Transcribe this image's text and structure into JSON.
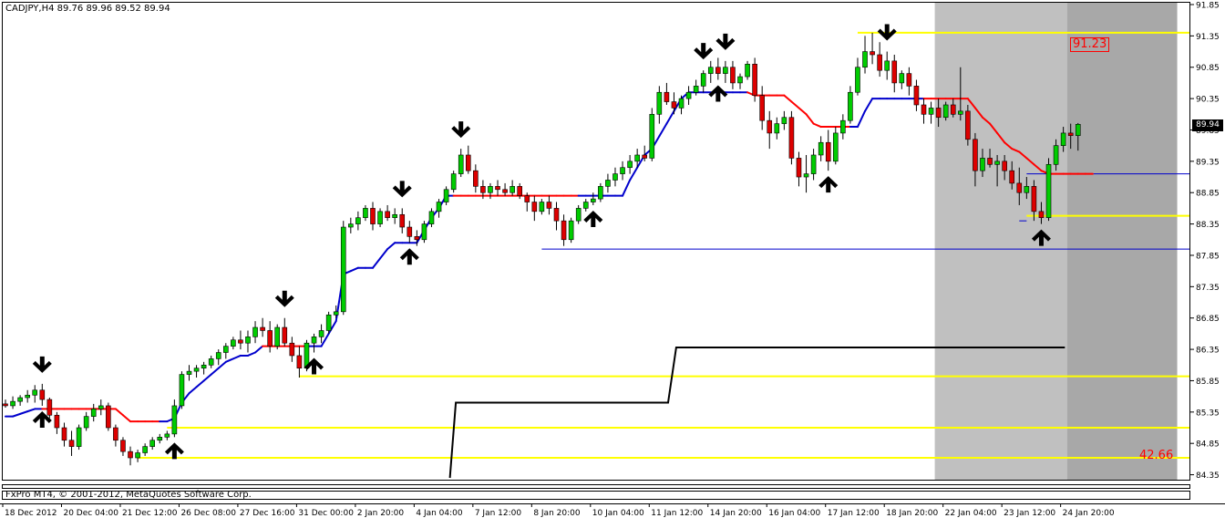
{
  "chart_header": {
    "symbol_line": "CADJPY,H4  89.76 89.96 89.52 89.94"
  },
  "footer": {
    "copyright": "FxPro MT4, © 2001-2012, MetaQuotes Software Corp."
  },
  "labels": {
    "current_price": "89.94",
    "high_level": "91.23",
    "low_level": "42.66"
  },
  "colors": {
    "bull_candle": "#00cc00",
    "bear_candle": "#dd0000",
    "trend_up": "#0000cc",
    "trend_down": "#ff0000",
    "level_line": "#ffff00",
    "step_line": "#000000",
    "shade_light": "#c0c0c0",
    "shade_dark": "#a8a8a8"
  },
  "chart_data": {
    "type": "candlestick",
    "symbol": "CADJPY",
    "timeframe": "H4",
    "ylim": [
      84.3,
      91.85
    ],
    "y_ticks": [
      "91.85",
      "91.35",
      "90.85",
      "90.35",
      "89.85",
      "89.35",
      "88.85",
      "88.35",
      "87.85",
      "87.35",
      "86.85",
      "86.35",
      "85.85",
      "85.35",
      "84.85",
      "84.35"
    ],
    "x_ticks": [
      {
        "label": "18 Dec 2012",
        "index": 0
      },
      {
        "label": "20 Dec 04:00",
        "index": 8
      },
      {
        "label": "21 Dec 12:00",
        "index": 16
      },
      {
        "label": "26 Dec 08:00",
        "index": 24
      },
      {
        "label": "27 Dec 16:00",
        "index": 32
      },
      {
        "label": "31 Dec 00:00",
        "index": 40
      },
      {
        "label": "2 Jan 20:00",
        "index": 48
      },
      {
        "label": "4 Jan 04:00",
        "index": 56
      },
      {
        "label": "7 Jan 12:00",
        "index": 64
      },
      {
        "label": "8 Jan 20:00",
        "index": 72
      },
      {
        "label": "10 Jan 04:00",
        "index": 80
      },
      {
        "label": "11 Jan 12:00",
        "index": 88
      },
      {
        "label": "14 Jan 20:00",
        "index": 96
      },
      {
        "label": "16 Jan 04:00",
        "index": 104
      },
      {
        "label": "17 Jan 12:00",
        "index": 112
      },
      {
        "label": "18 Jan 20:00",
        "index": 120
      },
      {
        "label": "22 Jan 04:00",
        "index": 128
      },
      {
        "label": "23 Jan 12:00",
        "index": 136
      },
      {
        "label": "24 Jan 20:00",
        "index": 144
      }
    ],
    "candles": [
      [
        85.48,
        85.55,
        85.42,
        85.45
      ],
      [
        85.45,
        85.6,
        85.4,
        85.52
      ],
      [
        85.52,
        85.62,
        85.45,
        85.58
      ],
      [
        85.58,
        85.7,
        85.5,
        85.62
      ],
      [
        85.62,
        85.78,
        85.5,
        85.7
      ],
      [
        85.7,
        85.8,
        85.45,
        85.55
      ],
      [
        85.55,
        85.58,
        85.25,
        85.3
      ],
      [
        85.3,
        85.35,
        85.0,
        85.1
      ],
      [
        85.1,
        85.18,
        84.8,
        84.9
      ],
      [
        84.9,
        85.05,
        84.65,
        84.8
      ],
      [
        84.8,
        85.15,
        84.75,
        85.1
      ],
      [
        85.1,
        85.35,
        85.05,
        85.28
      ],
      [
        85.28,
        85.48,
        85.2,
        85.4
      ],
      [
        85.4,
        85.55,
        85.3,
        85.45
      ],
      [
        85.45,
        85.5,
        85.05,
        85.1
      ],
      [
        85.1,
        85.15,
        84.8,
        84.9
      ],
      [
        84.9,
        84.95,
        84.65,
        84.72
      ],
      [
        84.72,
        84.8,
        84.5,
        84.62
      ],
      [
        84.62,
        84.75,
        84.55,
        84.7
      ],
      [
        84.7,
        84.85,
        84.65,
        84.8
      ],
      [
        84.8,
        84.95,
        84.75,
        84.9
      ],
      [
        84.9,
        85.0,
        84.85,
        84.95
      ],
      [
        84.95,
        85.05,
        84.9,
        85.0
      ],
      [
        85.0,
        85.55,
        84.95,
        85.45
      ],
      [
        85.45,
        86.0,
        85.4,
        85.95
      ],
      [
        85.95,
        86.1,
        85.85,
        86.0
      ],
      [
        86.0,
        86.1,
        85.9,
        86.05
      ],
      [
        86.05,
        86.15,
        85.95,
        86.1
      ],
      [
        86.1,
        86.25,
        86.05,
        86.2
      ],
      [
        86.2,
        86.35,
        86.1,
        86.3
      ],
      [
        86.3,
        86.45,
        86.2,
        86.4
      ],
      [
        86.4,
        86.55,
        86.35,
        86.5
      ],
      [
        86.5,
        86.65,
        86.35,
        86.45
      ],
      [
        86.45,
        86.65,
        86.3,
        86.55
      ],
      [
        86.55,
        86.8,
        86.45,
        86.7
      ],
      [
        86.7,
        86.85,
        86.55,
        86.65
      ],
      [
        86.65,
        86.8,
        86.3,
        86.4
      ],
      [
        86.4,
        86.75,
        86.35,
        86.7
      ],
      [
        86.7,
        86.85,
        86.4,
        86.45
      ],
      [
        86.45,
        86.55,
        86.15,
        86.25
      ],
      [
        86.25,
        86.4,
        85.9,
        86.05
      ],
      [
        86.05,
        86.5,
        86.0,
        86.45
      ],
      [
        86.45,
        86.6,
        86.3,
        86.55
      ],
      [
        86.55,
        86.75,
        86.45,
        86.65
      ],
      [
        86.65,
        86.95,
        86.6,
        86.9
      ],
      [
        86.9,
        87.05,
        86.85,
        86.95
      ],
      [
        86.95,
        88.4,
        86.9,
        88.3
      ],
      [
        88.3,
        88.45,
        88.2,
        88.35
      ],
      [
        88.35,
        88.55,
        88.25,
        88.45
      ],
      [
        88.45,
        88.65,
        88.4,
        88.6
      ],
      [
        88.6,
        88.7,
        88.25,
        88.35
      ],
      [
        88.35,
        88.6,
        88.3,
        88.55
      ],
      [
        88.55,
        88.65,
        88.4,
        88.45
      ],
      [
        88.45,
        88.6,
        88.35,
        88.5
      ],
      [
        88.5,
        88.6,
        88.2,
        88.3
      ],
      [
        88.3,
        88.4,
        88.05,
        88.15
      ],
      [
        88.15,
        88.25,
        88.0,
        88.1
      ],
      [
        88.1,
        88.4,
        88.05,
        88.35
      ],
      [
        88.35,
        88.6,
        88.3,
        88.55
      ],
      [
        88.55,
        88.75,
        88.45,
        88.7
      ],
      [
        88.7,
        88.95,
        88.65,
        88.9
      ],
      [
        88.9,
        89.2,
        88.85,
        89.15
      ],
      [
        89.15,
        89.55,
        89.1,
        89.45
      ],
      [
        89.45,
        89.6,
        89.15,
        89.2
      ],
      [
        89.2,
        89.3,
        88.85,
        88.95
      ],
      [
        88.95,
        89.05,
        88.75,
        88.85
      ],
      [
        88.85,
        89.0,
        88.75,
        88.95
      ],
      [
        88.95,
        89.05,
        88.8,
        88.9
      ],
      [
        88.9,
        89.0,
        88.8,
        88.85
      ],
      [
        88.85,
        89.05,
        88.8,
        88.95
      ],
      [
        88.95,
        89.0,
        88.75,
        88.8
      ],
      [
        88.8,
        88.85,
        88.55,
        88.7
      ],
      [
        88.7,
        88.8,
        88.4,
        88.55
      ],
      [
        88.55,
        88.75,
        88.5,
        88.7
      ],
      [
        88.7,
        88.8,
        88.5,
        88.6
      ],
      [
        88.6,
        88.7,
        88.25,
        88.4
      ],
      [
        88.4,
        88.5,
        88.0,
        88.1
      ],
      [
        88.1,
        88.45,
        88.05,
        88.4
      ],
      [
        88.4,
        88.65,
        88.35,
        88.6
      ],
      [
        88.6,
        88.75,
        88.55,
        88.7
      ],
      [
        88.7,
        88.85,
        88.65,
        88.75
      ],
      [
        88.75,
        89.0,
        88.7,
        88.95
      ],
      [
        88.95,
        89.15,
        88.85,
        89.05
      ],
      [
        89.05,
        89.25,
        88.95,
        89.15
      ],
      [
        89.15,
        89.35,
        89.05,
        89.25
      ],
      [
        89.25,
        89.45,
        89.15,
        89.35
      ],
      [
        89.35,
        89.55,
        89.25,
        89.45
      ],
      [
        89.45,
        89.6,
        89.35,
        89.4
      ],
      [
        89.4,
        90.2,
        89.35,
        90.1
      ],
      [
        90.1,
        90.55,
        89.95,
        90.45
      ],
      [
        90.45,
        90.6,
        90.25,
        90.3
      ],
      [
        90.3,
        90.45,
        90.1,
        90.2
      ],
      [
        90.2,
        90.4,
        90.1,
        90.35
      ],
      [
        90.35,
        90.55,
        90.25,
        90.45
      ],
      [
        90.45,
        90.65,
        90.4,
        90.55
      ],
      [
        90.55,
        90.8,
        90.45,
        90.75
      ],
      [
        90.75,
        90.95,
        90.6,
        90.85
      ],
      [
        90.85,
        91.0,
        90.65,
        90.75
      ],
      [
        90.75,
        90.95,
        90.6,
        90.85
      ],
      [
        90.85,
        90.95,
        90.5,
        90.6
      ],
      [
        90.6,
        90.75,
        90.5,
        90.7
      ],
      [
        90.7,
        90.95,
        90.65,
        90.9
      ],
      [
        90.9,
        91.0,
        90.3,
        90.4
      ],
      [
        90.4,
        90.55,
        89.85,
        90.0
      ],
      [
        90.0,
        90.15,
        89.55,
        89.8
      ],
      [
        89.8,
        90.05,
        89.7,
        89.95
      ],
      [
        89.95,
        90.15,
        89.85,
        90.05
      ],
      [
        90.05,
        90.15,
        89.3,
        89.4
      ],
      [
        89.4,
        89.5,
        88.95,
        89.1
      ],
      [
        89.1,
        89.45,
        88.85,
        89.15
      ],
      [
        89.15,
        89.55,
        89.05,
        89.45
      ],
      [
        89.45,
        89.75,
        89.35,
        89.65
      ],
      [
        89.65,
        89.85,
        89.2,
        89.35
      ],
      [
        89.35,
        89.9,
        89.3,
        89.8
      ],
      [
        89.8,
        90.1,
        89.7,
        90.0
      ],
      [
        90.0,
        90.55,
        89.95,
        90.45
      ],
      [
        90.45,
        91.0,
        90.4,
        90.85
      ],
      [
        90.85,
        91.35,
        90.75,
        91.1
      ],
      [
        91.1,
        91.4,
        90.9,
        91.05
      ],
      [
        91.05,
        91.25,
        90.7,
        90.8
      ],
      [
        90.8,
        91.1,
        90.65,
        90.95
      ],
      [
        90.95,
        91.05,
        90.45,
        90.6
      ],
      [
        90.6,
        90.8,
        90.5,
        90.75
      ],
      [
        90.75,
        90.85,
        90.4,
        90.55
      ],
      [
        90.55,
        90.65,
        90.15,
        90.25
      ],
      [
        90.25,
        90.35,
        89.95,
        90.1
      ],
      [
        90.1,
        90.3,
        89.95,
        90.2
      ],
      [
        90.2,
        90.35,
        89.9,
        90.05
      ],
      [
        90.05,
        90.3,
        90.0,
        90.25
      ],
      [
        90.25,
        90.35,
        90.05,
        90.1
      ],
      [
        90.1,
        90.85,
        90.0,
        90.15
      ],
      [
        90.15,
        90.25,
        89.6,
        89.7
      ],
      [
        89.7,
        89.8,
        88.95,
        89.2
      ],
      [
        89.2,
        89.55,
        89.1,
        89.4
      ],
      [
        89.4,
        89.55,
        89.25,
        89.3
      ],
      [
        89.3,
        89.45,
        88.95,
        89.35
      ],
      [
        89.35,
        89.45,
        89.05,
        89.2
      ],
      [
        89.2,
        89.35,
        88.9,
        89.0
      ],
      [
        89.0,
        89.25,
        88.65,
        88.85
      ],
      [
        88.85,
        89.1,
        88.75,
        88.95
      ],
      [
        88.95,
        89.05,
        88.4,
        88.55
      ],
      [
        88.55,
        88.7,
        88.35,
        88.45
      ],
      [
        88.45,
        89.4,
        88.4,
        89.3
      ],
      [
        89.3,
        89.7,
        89.2,
        89.6
      ],
      [
        89.6,
        89.9,
        89.5,
        89.8
      ],
      [
        89.8,
        89.95,
        89.55,
        89.76
      ],
      [
        89.76,
        89.96,
        89.52,
        89.94
      ]
    ],
    "trend_line": {
      "start_index": 0,
      "values": [
        85.28,
        85.28,
        85.32,
        85.36,
        85.4,
        85.4,
        85.4,
        85.4,
        85.4,
        85.4,
        85.4,
        85.4,
        85.4,
        85.4,
        85.4,
        85.4,
        85.3,
        85.2,
        85.2,
        85.2,
        85.2,
        85.2,
        85.2,
        85.25,
        85.5,
        85.65,
        85.75,
        85.85,
        85.95,
        86.05,
        86.15,
        86.2,
        86.25,
        86.25,
        86.3,
        86.4,
        86.4,
        86.4,
        86.4,
        86.4,
        86.4,
        86.4,
        86.4,
        86.4,
        86.6,
        86.8,
        87.55,
        87.6,
        87.65,
        87.65,
        87.65,
        87.8,
        87.95,
        88.05,
        88.05,
        88.05,
        88.05,
        88.25,
        88.45,
        88.6,
        88.8,
        88.8,
        88.8,
        88.8,
        88.8,
        88.8,
        88.8,
        88.8,
        88.8,
        88.8,
        88.8,
        88.8,
        88.8,
        88.8,
        88.8,
        88.8,
        88.8,
        88.8,
        88.8,
        88.8,
        88.8,
        88.8,
        88.8,
        88.8,
        88.8,
        89.05,
        89.25,
        89.45,
        89.55,
        89.75,
        89.95,
        90.15,
        90.35,
        90.45,
        90.45,
        90.45,
        90.45,
        90.45,
        90.45,
        90.45,
        90.45,
        90.45,
        90.4,
        90.4,
        90.4,
        90.4,
        90.4,
        90.3,
        90.2,
        90.1,
        89.95,
        89.9,
        89.9,
        89.9,
        89.9,
        89.9,
        89.9,
        90.15,
        90.35,
        90.35,
        90.35,
        90.35,
        90.35,
        90.35,
        90.35,
        90.35,
        90.35,
        90.35,
        90.35,
        90.35,
        90.35,
        90.35,
        90.2,
        90.05,
        89.95,
        89.8,
        89.65,
        89.55,
        89.5,
        89.4,
        89.3,
        89.2,
        89.15,
        89.15,
        89.15,
        89.15,
        89.15,
        89.15,
        89.15
      ],
      "direction": [
        1,
        1,
        1,
        1,
        1,
        1,
        0,
        0,
        0,
        0,
        0,
        0,
        0,
        0,
        0,
        0,
        0,
        0,
        0,
        0,
        0,
        0,
        1,
        1,
        1,
        1,
        1,
        1,
        1,
        1,
        1,
        1,
        1,
        1,
        1,
        1,
        0,
        0,
        0,
        0,
        0,
        0,
        1,
        1,
        1,
        1,
        1,
        1,
        1,
        1,
        1,
        1,
        1,
        1,
        1,
        1,
        1,
        1,
        1,
        1,
        1,
        1,
        0,
        0,
        0,
        0,
        0,
        0,
        0,
        0,
        0,
        0,
        0,
        0,
        0,
        0,
        0,
        0,
        0,
        1,
        1,
        1,
        1,
        1,
        1,
        1,
        1,
        1,
        1,
        1,
        1,
        1,
        1,
        1,
        1,
        1,
        1,
        1,
        1,
        1,
        1,
        1,
        0,
        0,
        0,
        0,
        0,
        0,
        0,
        0,
        0,
        0,
        0,
        0,
        0,
        0,
        1,
        1,
        1,
        1,
        1,
        1,
        1,
        1,
        1,
        1,
        0,
        0,
        0,
        0,
        0,
        0,
        0,
        0,
        0,
        0,
        0,
        0,
        0,
        0,
        0,
        0,
        0,
        0,
        0,
        0,
        0,
        0,
        0,
        0,
        1,
        1,
        1,
        1,
        1,
        1,
        1
      ]
    },
    "signals": [
      {
        "index": 5,
        "type": "sell"
      },
      {
        "index": 5,
        "type": "buy"
      },
      {
        "index": 23,
        "type": "buy"
      },
      {
        "index": 38,
        "type": "sell"
      },
      {
        "index": 42,
        "type": "buy"
      },
      {
        "index": 54,
        "type": "sell"
      },
      {
        "index": 55,
        "type": "buy"
      },
      {
        "index": 62,
        "type": "sell"
      },
      {
        "index": 80,
        "type": "buy"
      },
      {
        "index": 95,
        "type": "sell"
      },
      {
        "index": 97,
        "type": "buy"
      },
      {
        "index": 98,
        "type": "sell"
      },
      {
        "index": 112,
        "type": "buy"
      },
      {
        "index": 120,
        "type": "sell"
      },
      {
        "index": 141,
        "type": "buy"
      }
    ],
    "horizontal_levels": [
      {
        "value": 91.4,
        "from_index": 116,
        "color": "yellow"
      },
      {
        "value": 88.48,
        "from_index": 139,
        "color": "yellow"
      },
      {
        "value": 89.15,
        "from_index": 139,
        "color": "blue"
      },
      {
        "value": 87.95,
        "from_index": 73,
        "color": "blue"
      },
      {
        "value": 88.4,
        "from_index": 138,
        "to_index": 139,
        "color": "blue"
      },
      {
        "value": 85.92,
        "from_index": 40,
        "color": "yellow"
      },
      {
        "value": 85.1,
        "from_index": 22,
        "color": "yellow"
      },
      {
        "value": 84.62,
        "from_index": 18,
        "color": "yellow"
      }
    ],
    "step_line": [
      {
        "index": 60.5,
        "value": 84.3
      },
      {
        "index": 61.3,
        "value": 85.5
      },
      {
        "index": 90.2,
        "value": 85.5
      },
      {
        "index": 91.3,
        "value": 86.38
      },
      {
        "index": 144.2,
        "value": 86.38
      }
    ],
    "shaded_regions": [
      {
        "from_index": 127,
        "to_index": 145,
        "shade": "light"
      },
      {
        "from_index": 145,
        "to_index": 160,
        "shade": "dark"
      }
    ]
  }
}
